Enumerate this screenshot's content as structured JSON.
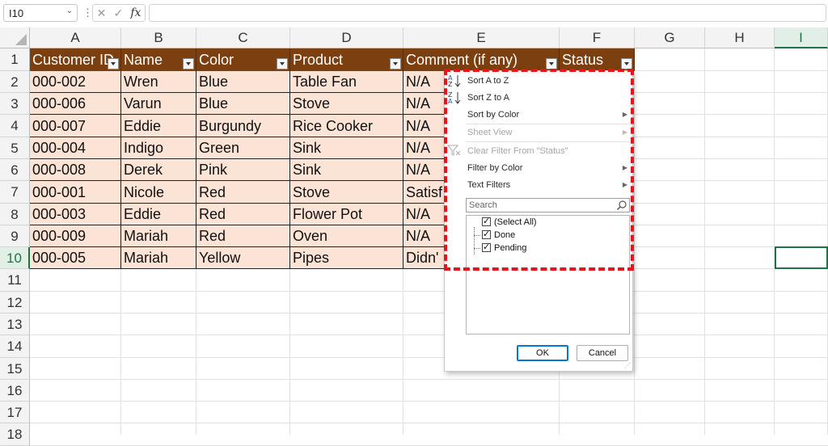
{
  "formula_bar": {
    "name_box": "I10",
    "cancel_glyph": "✕",
    "enter_glyph": "✓",
    "fx": "fx",
    "formula": ""
  },
  "columns": [
    "A",
    "B",
    "C",
    "D",
    "E",
    "F",
    "G",
    "H",
    "I"
  ],
  "selected_column": "I",
  "rows": [
    "1",
    "2",
    "3",
    "4",
    "5",
    "6",
    "7",
    "8",
    "9",
    "10",
    "11",
    "12",
    "13",
    "14",
    "15",
    "16",
    "17",
    "18"
  ],
  "selected_row": "10",
  "table": {
    "headers": [
      "Customer ID",
      "Name",
      "Color",
      "Product",
      "Comment (if any)",
      "Status"
    ],
    "rows": [
      [
        "000-002",
        "Wren",
        "Blue",
        "Table Fan",
        "N/A"
      ],
      [
        "000-006",
        "Varun",
        "Blue",
        "Stove",
        "N/A"
      ],
      [
        "000-007",
        "Eddie",
        "Burgundy",
        "Rice Cooker",
        "N/A"
      ],
      [
        "000-004",
        "Indigo",
        "Green",
        "Sink",
        "N/A"
      ],
      [
        "000-008",
        "Derek",
        "Pink",
        "Sink",
        "N/A"
      ],
      [
        "000-001",
        "Nicole",
        "Red",
        "Stove",
        "Satisf"
      ],
      [
        "000-003",
        "Eddie",
        "Red",
        "Flower Pot",
        "N/A"
      ],
      [
        "000-009",
        "Mariah",
        "Red",
        "Oven",
        "N/A"
      ],
      [
        "000-005",
        "Mariah",
        "Yellow",
        "Pipes",
        "Didn'"
      ]
    ]
  },
  "filter_menu": {
    "sort_az": "Sort A to Z",
    "sort_za": "Sort Z to A",
    "sort_by_color": "Sort by Color",
    "sheet_view": "Sheet View",
    "clear_filter": "Clear Filter From \"Status\"",
    "filter_by_color": "Filter by Color",
    "text_filters": "Text Filters",
    "search_placeholder": "Search",
    "items": [
      "(Select All)",
      "Done",
      "Pending"
    ],
    "ok": "OK",
    "cancel": "Cancel"
  },
  "colors": {
    "header_fill": "#7b3f10",
    "row_fill": "#fbe3d6",
    "highlight": "#e8131b",
    "excel_green": "#217346"
  }
}
